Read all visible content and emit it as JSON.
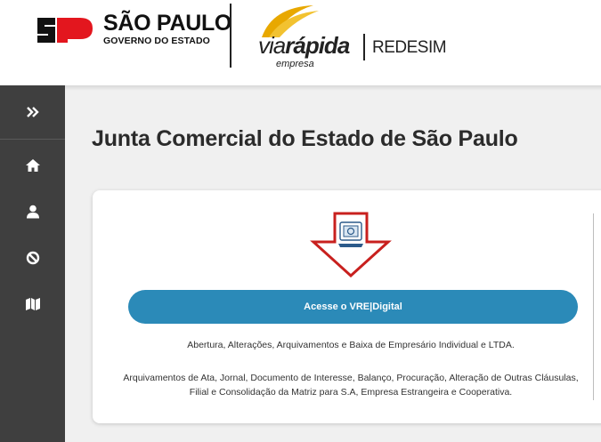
{
  "header": {
    "sp_title": "SÃO PAULO",
    "sp_subtitle": "GOVERNO DO ESTADO",
    "vr_prefix": "via",
    "vr_bold": "rápida",
    "vr_empresa": "empresa",
    "redesim": "REDESIM"
  },
  "sidebar": {
    "toggle_icon": "double-chevron-right-icon",
    "items": [
      {
        "icon": "home-icon"
      },
      {
        "icon": "user-icon"
      },
      {
        "icon": "ban-icon"
      },
      {
        "icon": "map-icon"
      }
    ]
  },
  "main": {
    "page_title": "Junta Comercial do Estado de São Paulo",
    "card": {
      "button_label": "Acesse o VRE|Digital",
      "description_1": "Abertura, Alterações, Arquivamentos e Baixa de Empresário Individual e LTDA.",
      "description_2": "Arquivamentos de Ata, Jornal, Documento de Interesse, Balanço, Procuração, Alteração de Outras Cláusulas, Filial e Consolidação da Matriz para S.A, Empresa Estrangeira e Cooperativa."
    }
  },
  "colors": {
    "sidebar_bg": "#3f3f3f",
    "button_bg": "#2b8ab8",
    "arrow_red": "#c8201e",
    "sp_red": "#e3161e",
    "vr_gold": "#e8a800"
  }
}
